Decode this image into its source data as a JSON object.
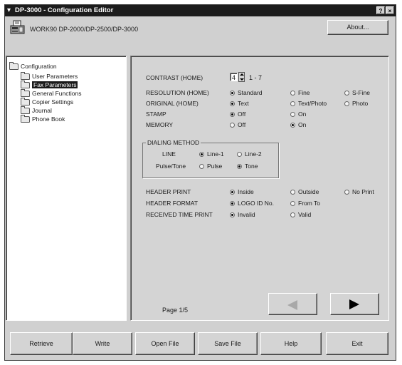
{
  "window": {
    "title": "DP-3000 - Configuration Editor",
    "help_btn": "?",
    "close_btn": "×"
  },
  "header": {
    "model": "WORK90 DP-2000/DP-2500/DP-3000",
    "about_label": "About..."
  },
  "tree": {
    "root": "Configuration",
    "items": [
      "User Parameters",
      "Fax Parameters",
      "General Functions",
      "Copier Settings",
      "Journal",
      "Phone Book"
    ],
    "selected": "Fax Parameters"
  },
  "fields": {
    "contrast": {
      "label": "CONTRAST (HOME)",
      "value": "4",
      "range": "1 - 7"
    },
    "resolution": {
      "label": "RESOLUTION (HOME)",
      "options": [
        "Standard",
        "Fine",
        "S-Fine"
      ],
      "selected": "Standard"
    },
    "original": {
      "label": "ORIGINAL (HOME)",
      "options": [
        "Text",
        "Text/Photo",
        "Photo"
      ],
      "selected": "Text"
    },
    "stamp": {
      "label": "STAMP",
      "options": [
        "Off",
        "On"
      ],
      "selected": "Off"
    },
    "memory": {
      "label": "MEMORY",
      "options": [
        "Off",
        "On"
      ],
      "selected": "On"
    },
    "dialing": {
      "title": "DIALING METHOD",
      "line": {
        "label": "LINE",
        "options": [
          "Line-1",
          "Line-2"
        ],
        "selected": "Line-1"
      },
      "pulse_tone": {
        "label": "Pulse/Tone",
        "options": [
          "Pulse",
          "Tone"
        ],
        "selected": "Tone"
      }
    },
    "header_print": {
      "label": "HEADER PRINT",
      "options": [
        "Inside",
        "Outside",
        "No Print"
      ],
      "selected": "Inside"
    },
    "header_format": {
      "label": "HEADER FORMAT",
      "options": [
        "LOGO ID No.",
        "From To"
      ],
      "selected": "LOGO ID No."
    },
    "received_time": {
      "label": "RECEIVED TIME PRINT",
      "options": [
        "Invalid",
        "Valid"
      ],
      "selected": "Invalid"
    }
  },
  "pager": {
    "label": "Page 1/5"
  },
  "buttons": [
    "Retrieve",
    "Write",
    "Open File",
    "Save File",
    "Help",
    "Exit"
  ]
}
